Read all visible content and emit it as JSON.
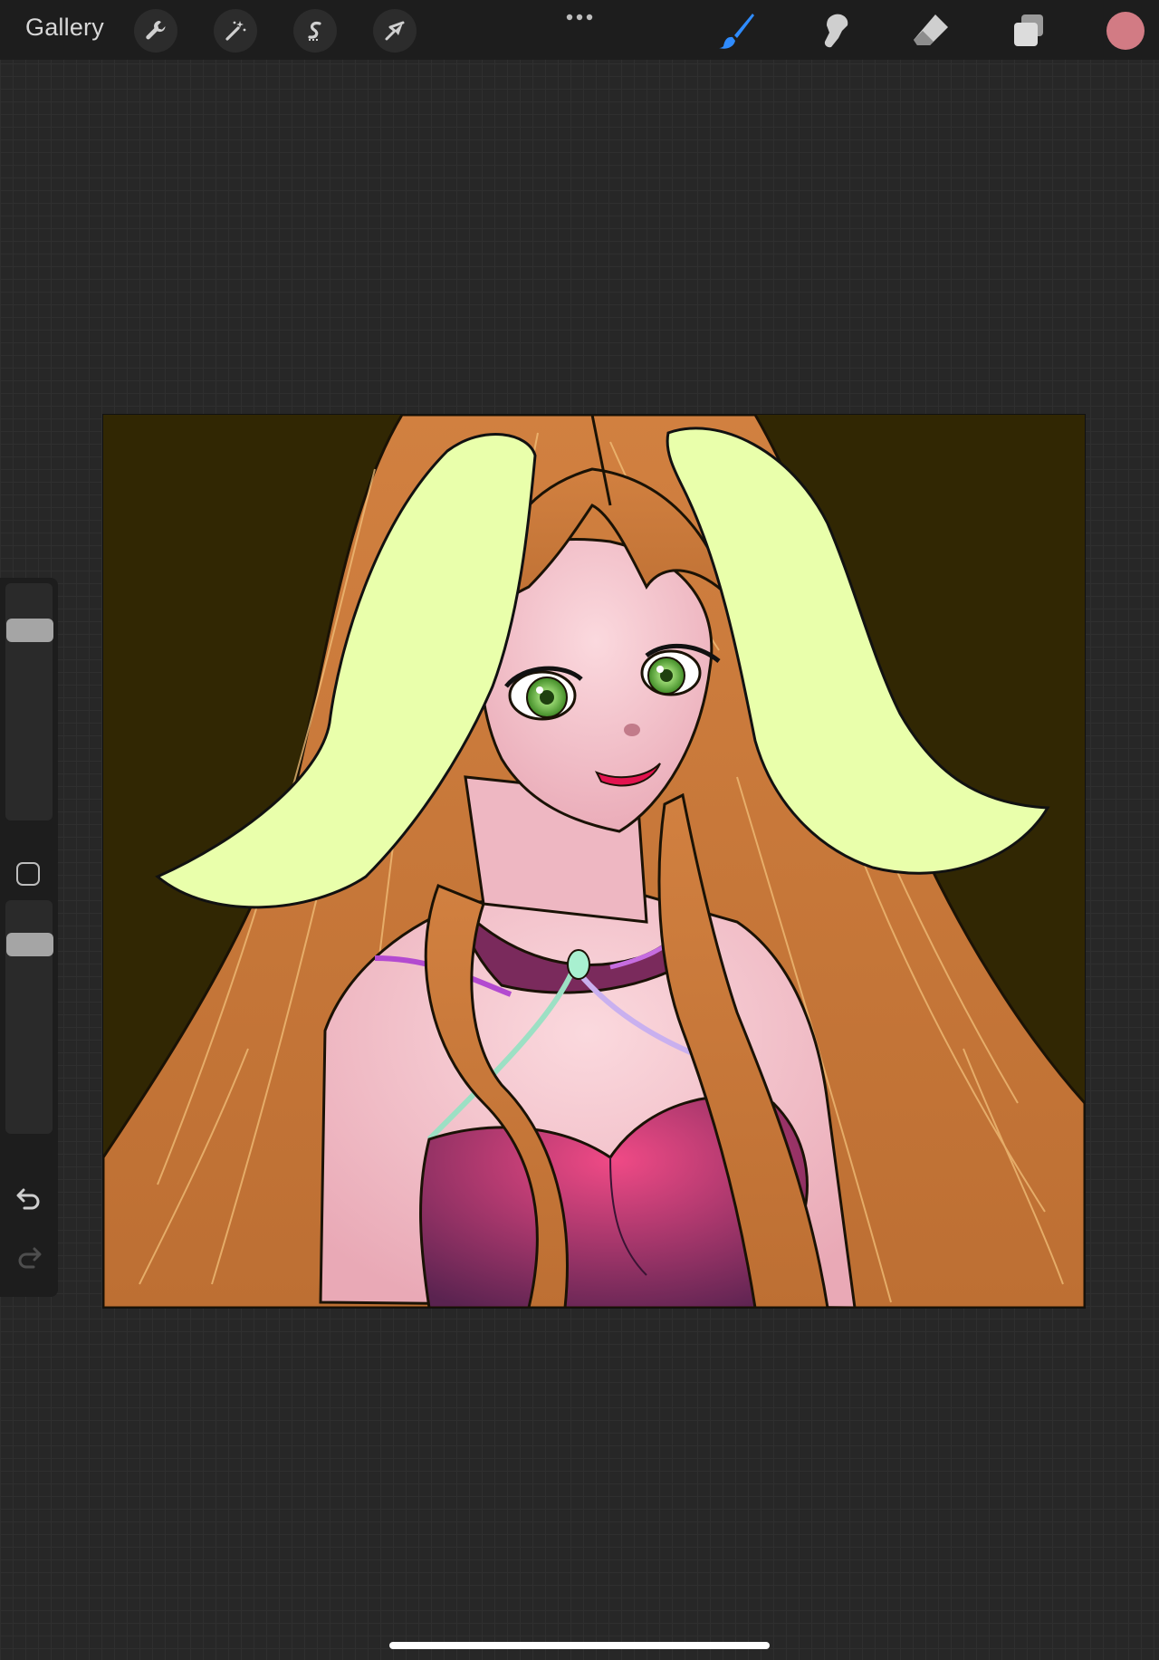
{
  "toolbar": {
    "gallery_label": "Gallery",
    "left_tools": [
      {
        "name": "actions",
        "icon": "wrench-icon"
      },
      {
        "name": "adjustments",
        "icon": "magic-wand-icon"
      },
      {
        "name": "selection",
        "icon": "selection-s-icon"
      },
      {
        "name": "transform",
        "icon": "arrow-cursor-icon"
      }
    ],
    "more_icon": "more-dots-icon",
    "right_tools": [
      {
        "name": "brush",
        "icon": "brush-icon",
        "active": true,
        "color": "#2f8cff"
      },
      {
        "name": "smudge",
        "icon": "smudge-icon",
        "active": false
      },
      {
        "name": "eraser",
        "icon": "eraser-icon",
        "active": false
      },
      {
        "name": "layers",
        "icon": "layers-icon",
        "active": false
      }
    ],
    "current_color": "#d27b84"
  },
  "sidebar": {
    "brush_size_level": 0.95,
    "opacity_level": 0.95,
    "modifier_icon": "modifier-square-icon",
    "undo_icon": "undo-icon",
    "redo_icon": "redo-icon"
  },
  "canvas": {
    "background_color": "#312703",
    "hair_color": "#c5773a",
    "ears_color": "#e9ffab",
    "skin_color": "#f3c5cc",
    "dress_color": "#e0356f",
    "eye_color": "#7dd04f"
  }
}
